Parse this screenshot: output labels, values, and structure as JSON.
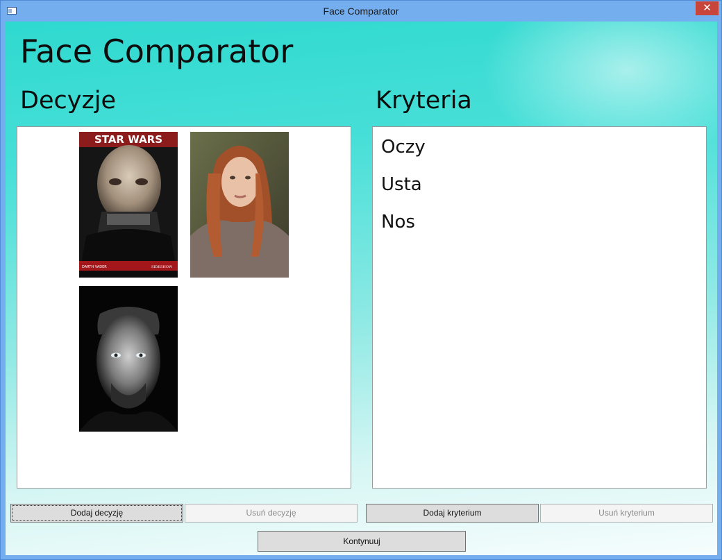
{
  "window": {
    "title": "Face Comparator",
    "close_glyph": "✕"
  },
  "header": {
    "title": "Face Comparator"
  },
  "decisions": {
    "title": "Decyzje",
    "photos": [
      {
        "name": "darth-vader-poster",
        "caption_top": "STAR WARS",
        "caption_left": "DARTH VADER",
        "caption_right": "SIDESHOW"
      },
      {
        "name": "red-haired-woman-portrait"
      },
      {
        "name": "bearded-man-portrait"
      }
    ]
  },
  "criteria": {
    "title": "Kryteria",
    "items": [
      "Oczy",
      "Usta",
      "Nos"
    ]
  },
  "buttons": {
    "add_decision": "Dodaj decyzję",
    "remove_decision": "Usuń decyzję",
    "add_criterion": "Dodaj kryterium",
    "remove_criterion": "Usuń kryterium",
    "continue": "Kontynuuj"
  },
  "colors": {
    "window_border": "#74aeee",
    "gradient_top": "#2fd9cf",
    "close_button": "#c7453a"
  }
}
